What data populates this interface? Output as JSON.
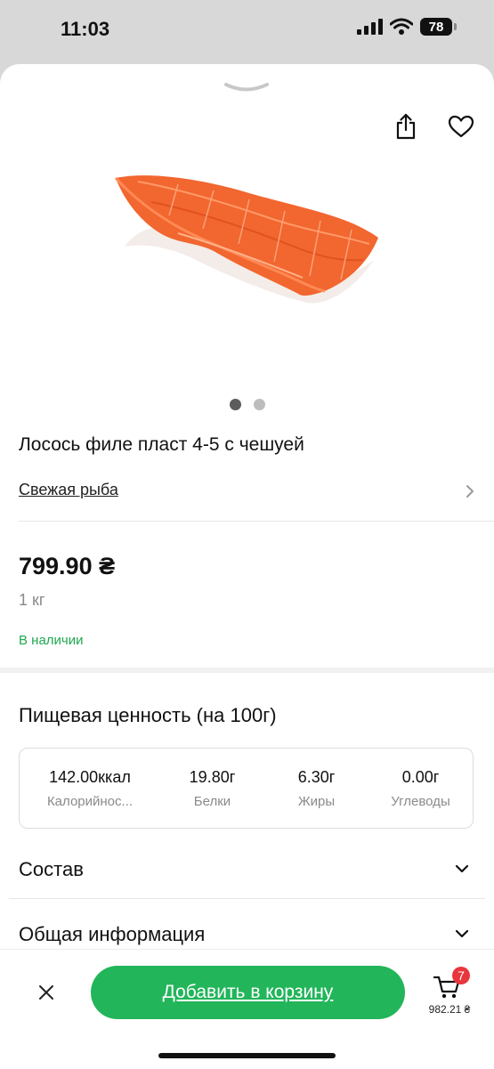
{
  "status_bar": {
    "time": "11:03",
    "battery": "78"
  },
  "icons": {
    "share": "share-icon",
    "favorite": "heart-icon",
    "close": "close-icon",
    "cart": "cart-icon",
    "category_chevron": "chevron-right-icon",
    "accordion_chevron": "chevron-down-icon",
    "grabber": "grabber-chevron-icon"
  },
  "product": {
    "image_count": 2,
    "active_image": 1,
    "title": "Лосось филе пласт 4-5 с чешуей",
    "category": "Свежая рыба",
    "price": "799.90 ₴",
    "unit": "1 кг",
    "stock": "В наличии"
  },
  "nutrition": {
    "title": "Пищевая ценность (на 100г)",
    "items": [
      {
        "value": "142.00ккал",
        "label": "Калорийнос..."
      },
      {
        "value": "19.80г",
        "label": "Белки"
      },
      {
        "value": "6.30г",
        "label": "Жиры"
      },
      {
        "value": "0.00г",
        "label": "Углеводы"
      }
    ]
  },
  "sections": [
    {
      "label": "Состав"
    },
    {
      "label": "Общая информация"
    }
  ],
  "bottom_bar": {
    "add_to_cart_label": "Добавить в корзину",
    "cart_count": "7",
    "cart_total": "982.21 ₴"
  },
  "colors": {
    "accent_green": "#22b55a",
    "stock_green": "#1ea84f",
    "badge_red": "#e8363d"
  }
}
